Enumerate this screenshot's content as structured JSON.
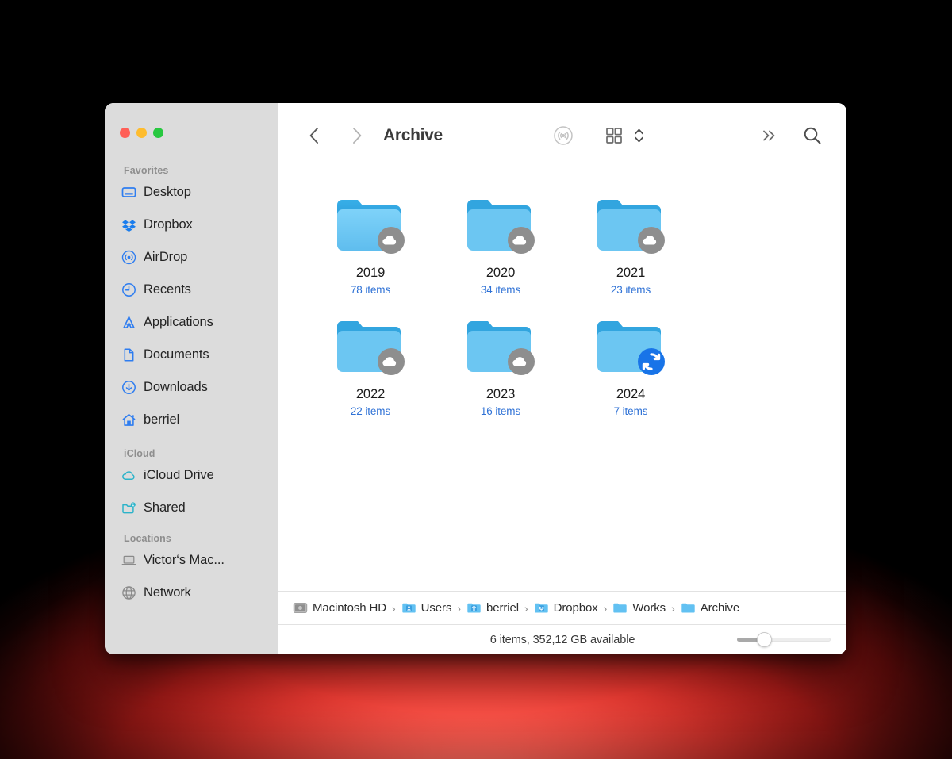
{
  "window": {
    "title": "Archive",
    "traffic_lights": [
      {
        "name": "close",
        "color": "#ff5f57"
      },
      {
        "name": "minimize",
        "color": "#febc2e"
      },
      {
        "name": "maximize",
        "color": "#28c840"
      }
    ]
  },
  "toolbar": {
    "back_icon": "chevron-left-icon",
    "forward_icon": "chevron-right-icon",
    "airdrop_icon": "airdrop-icon",
    "view_icon": "grid-view-icon",
    "view_chevrons_icon": "chevron-up-down-icon",
    "more_icon": "double-chevron-right-icon",
    "search_icon": "search-icon"
  },
  "sidebar": {
    "sections": [
      {
        "title": "Favorites",
        "items": [
          {
            "label": "Desktop",
            "icon": "desktop-icon",
            "tint": "blue"
          },
          {
            "label": "Dropbox",
            "icon": "dropbox-icon",
            "tint": "blue"
          },
          {
            "label": "AirDrop",
            "icon": "airdrop-icon",
            "tint": "blue"
          },
          {
            "label": "Recents",
            "icon": "clock-icon",
            "tint": "blue"
          },
          {
            "label": "Applications",
            "icon": "applications-icon",
            "tint": "blue"
          },
          {
            "label": "Documents",
            "icon": "document-icon",
            "tint": "blue"
          },
          {
            "label": "Downloads",
            "icon": "download-icon",
            "tint": "blue"
          },
          {
            "label": "berriel",
            "icon": "home-icon",
            "tint": "blue"
          }
        ]
      },
      {
        "title": "iCloud",
        "items": [
          {
            "label": "iCloud Drive",
            "icon": "cloud-icon",
            "tint": "cyan"
          },
          {
            "label": "Shared",
            "icon": "shared-folder-icon",
            "tint": "cyan"
          }
        ]
      },
      {
        "title": "Locations",
        "items": [
          {
            "label": "Victor‘s Mac...",
            "icon": "laptop-icon",
            "tint": "gray"
          },
          {
            "label": "Network",
            "icon": "network-icon",
            "tint": "gray"
          }
        ]
      }
    ]
  },
  "files": [
    {
      "name": "2019",
      "subtitle": "78 items",
      "badge": "cloud-badge"
    },
    {
      "name": "2020",
      "subtitle": "34 items",
      "badge": "cloud-badge"
    },
    {
      "name": "2021",
      "subtitle": "23 items",
      "badge": "cloud-badge"
    },
    {
      "name": "2022",
      "subtitle": "22 items",
      "badge": "cloud-badge"
    },
    {
      "name": "2023",
      "subtitle": "16 items",
      "badge": "cloud-badge"
    },
    {
      "name": "2024",
      "subtitle": "7 items",
      "badge": "sync-badge"
    }
  ],
  "breadcrumb": {
    "separator": "›",
    "items": [
      {
        "label": "Macintosh HD",
        "icon": "hard-disk-icon"
      },
      {
        "label": "Users",
        "icon": "users-folder-icon"
      },
      {
        "label": "berriel",
        "icon": "home-folder-icon"
      },
      {
        "label": "Dropbox",
        "icon": "dropbox-folder-icon"
      },
      {
        "label": "Works",
        "icon": "folder-icon"
      },
      {
        "label": "Archive",
        "icon": "folder-icon"
      }
    ]
  },
  "status": {
    "text": "6 items, 352,12 GB available",
    "zoom_percent": 25
  },
  "colors": {
    "accent_blue": "#2f72d6",
    "folder_blue": "#63c4f5",
    "sidebar_bg": "#dcdcdc",
    "icloud_cyan": "#2cb3c9",
    "sync_badge_blue": "#1874e8",
    "cloud_badge_gray": "#8e8e8e"
  }
}
